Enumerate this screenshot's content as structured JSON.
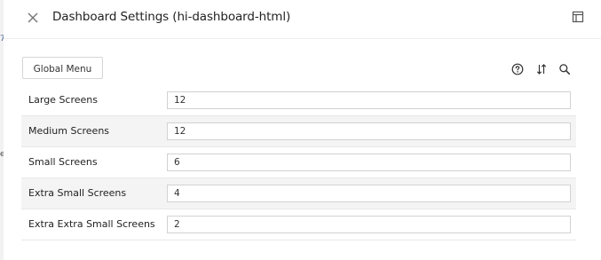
{
  "background_fragments": {
    "frag_1": "7",
    "frag_2": "e"
  },
  "header": {
    "title": "Dashboard Settings (hi-dashboard-html)",
    "close_icon": "close-icon",
    "layout_icon": "panel-layout-icon"
  },
  "toolbar": {
    "global_menu_label": "Global Menu",
    "icons": [
      "help-circle-icon",
      "sort-icon",
      "search-icon"
    ]
  },
  "settings": [
    {
      "label": "Large Screens",
      "value": "12"
    },
    {
      "label": "Medium Screens",
      "value": "12"
    },
    {
      "label": "Small Screens",
      "value": "6"
    },
    {
      "label": "Extra Small Screens",
      "value": "4"
    },
    {
      "label": "Extra Extra Small Screens",
      "value": "2"
    }
  ],
  "colors": {
    "row_alt_background": "#f4f4f4",
    "border": "#d2d2d2",
    "text": "#222222"
  }
}
